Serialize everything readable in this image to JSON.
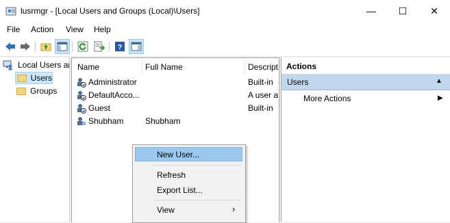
{
  "window": {
    "title": "lusrmgr - [Local Users and Groups (Local)\\Users]",
    "minimize_glyph": "—",
    "maximize_glyph": "☐",
    "close_glyph": "✕"
  },
  "menu": [
    "File",
    "Action",
    "View",
    "Help"
  ],
  "toolbar": {
    "icons": [
      "back-arrow-icon",
      "forward-arrow-icon",
      "up-folder-icon",
      "show-hide-tree-icon",
      "refresh-icon",
      "export-list-icon",
      "help-icon",
      "show-hide-action-pane-icon"
    ]
  },
  "tree": {
    "root": "Local Users ar",
    "items": [
      "Users",
      "Groups"
    ]
  },
  "list": {
    "columns": [
      "Name",
      "Full Name",
      "Descript"
    ],
    "rows": [
      {
        "name": "Administrator",
        "full_name": "",
        "description": "Built-in"
      },
      {
        "name": "DefaultAcco...",
        "full_name": "",
        "description": "A user a"
      },
      {
        "name": "Guest",
        "full_name": "",
        "description": "Built-in"
      },
      {
        "name": "Shubham",
        "full_name": "Shubham",
        "description": ""
      }
    ]
  },
  "actions": {
    "header": "Actions",
    "section": "Users",
    "more_actions": "More Actions",
    "collapse_glyph": "▲",
    "more_glyph": "▶"
  },
  "context_menu": {
    "items": [
      {
        "label": "New User...",
        "highlighted": true
      },
      {
        "label": "Refresh"
      },
      {
        "label": "Export List..."
      },
      {
        "label": "View",
        "submenu": "›"
      }
    ]
  },
  "colors": {
    "selection_blue": "#99c9ef",
    "actions_section": "#c0d7ee",
    "folder_yellow": "#f7d57b"
  }
}
